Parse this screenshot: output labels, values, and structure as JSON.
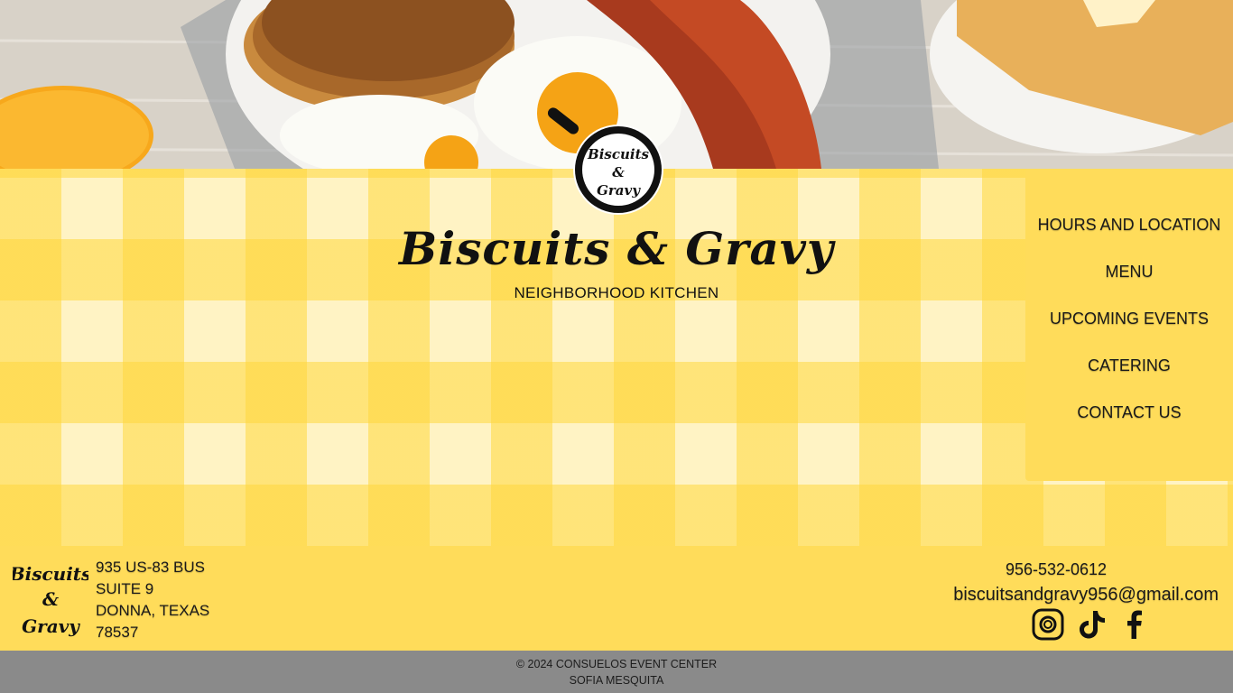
{
  "brand": {
    "title": "Biscuits & Gravy",
    "subtitle": "NEIGHBORHOOD KITCHEN",
    "logo_text_top": "Biscuits",
    "logo_text_mid": "&",
    "logo_text_bottom": "Gravy"
  },
  "nav": {
    "items": [
      {
        "label": "HOURS AND LOCATION"
      },
      {
        "label": "MENU"
      },
      {
        "label": "UPCOMING EVENTS"
      },
      {
        "label": "CATERING"
      },
      {
        "label": "CONTACT US"
      }
    ]
  },
  "footer": {
    "address": {
      "line1": "935 US-83 BUS",
      "line2": "SUITE 9",
      "line3": "DONNA, TEXAS",
      "line4": "78537"
    },
    "phone": "956-532-0612",
    "email": "biscuitsandgravy956@gmail.com",
    "socials": [
      {
        "name": "instagram-icon"
      },
      {
        "name": "tiktok-icon"
      },
      {
        "name": "facebook-icon"
      }
    ]
  },
  "copyright": {
    "line1": "© 2024 CONSUELOS EVENT CENTER",
    "line2": "SOFIA MESQUITA"
  },
  "colors": {
    "accent_yellow": "#ffdc5a",
    "gingham_light": "#fff3c4",
    "footer_bar": "#8a8a8a"
  }
}
